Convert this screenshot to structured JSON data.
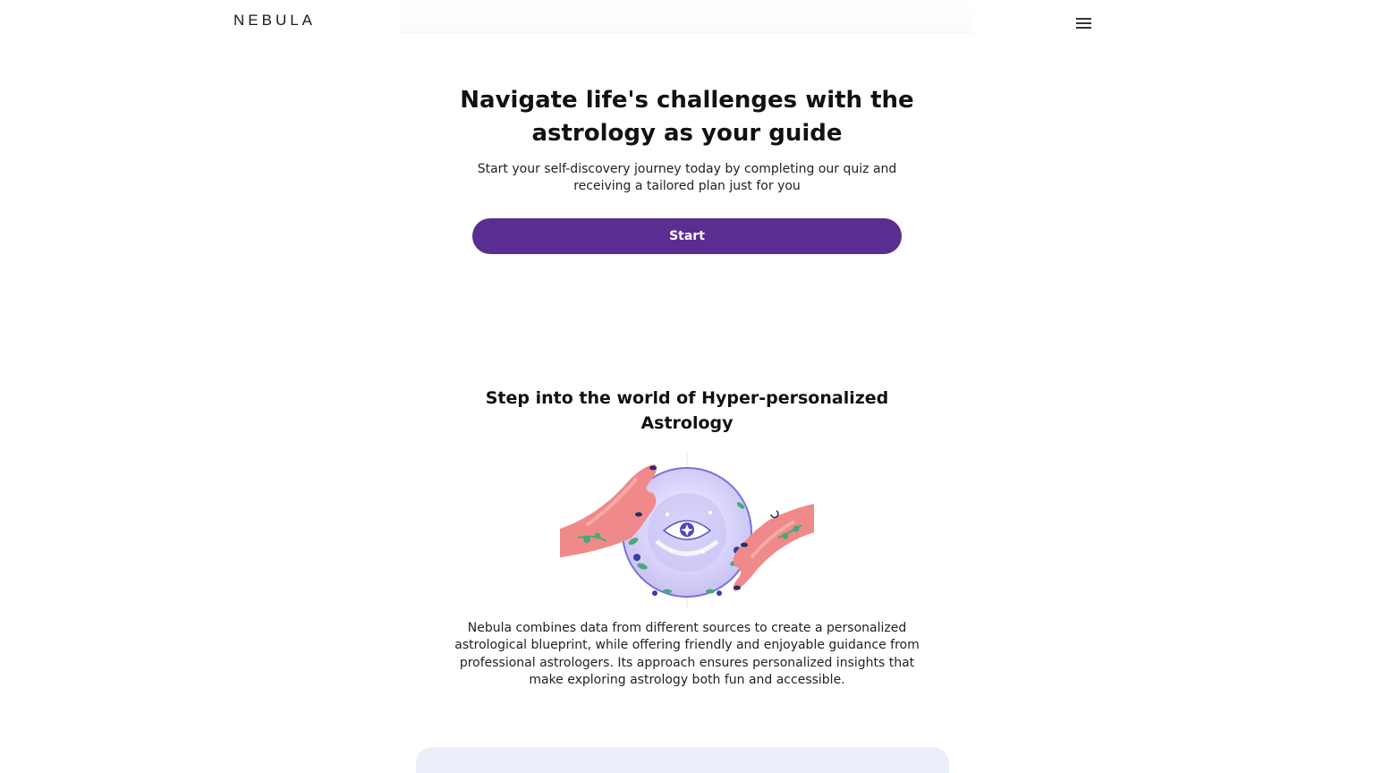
{
  "header": {
    "logo_text": "NEBULA",
    "menu_icon": "hamburger-menu-icon"
  },
  "hero": {
    "title": "Navigate life's challenges with the astrology as your guide",
    "subtitle": "Start your self-discovery journey today by completing our quiz and receiving a tailored plan just for you",
    "start_button_label": "Start",
    "accent_color": "#5a2d91"
  },
  "feature": {
    "title": "Step into the world of Hyper-personalized Astrology",
    "illustration": "hands-crystal-ball-eye-illustration",
    "body": "Nebula combines data from different sources to create a personalized astrological blueprint, while offering friendly and enjoyable guidance from professional astrologers. Its approach ensures personalized insights that make exploring astrology both fun and accessible."
  },
  "bottom_card": {
    "background_color": "#e9eef8"
  }
}
